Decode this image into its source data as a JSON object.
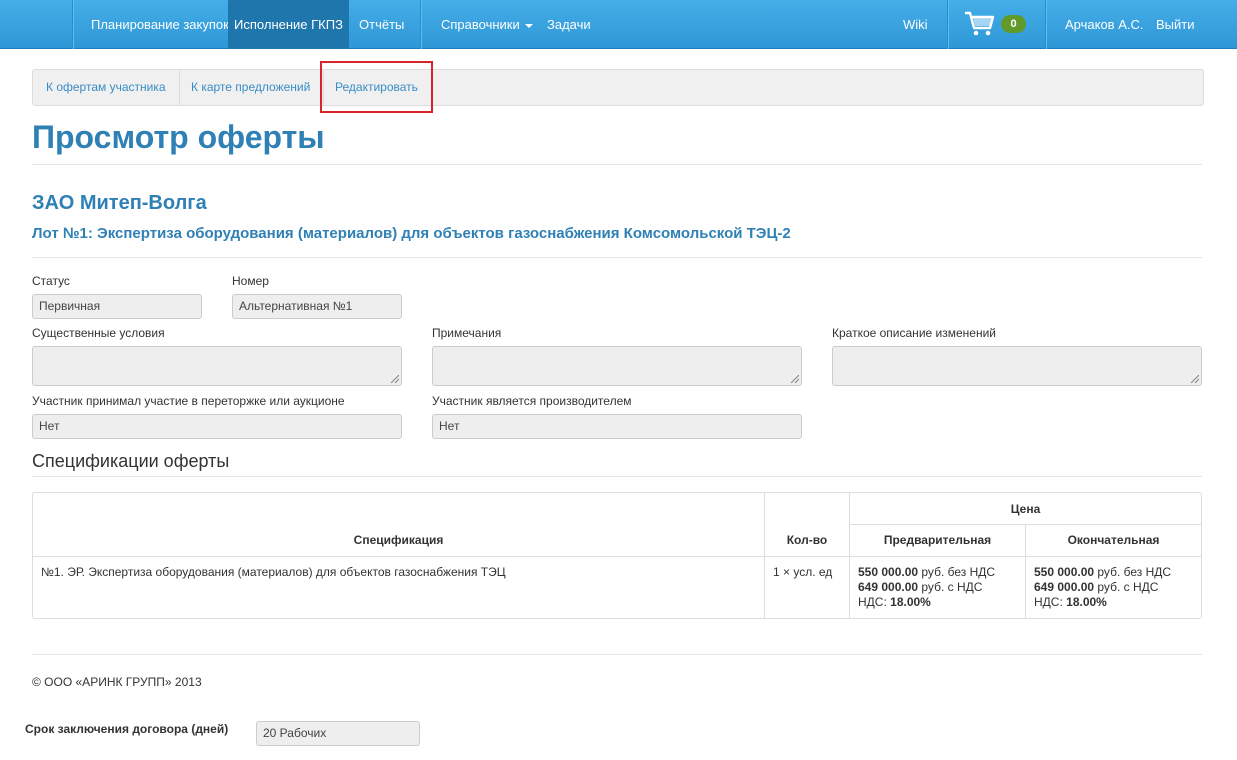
{
  "navbar": {
    "items": [
      "Планирование закупок",
      "Исполнение ГКПЗ",
      "Отчёты",
      "Справочники",
      "Задачи"
    ],
    "wiki": "Wiki",
    "cart_count": "0",
    "user": "Арчаков А.С.",
    "logout": "Выйти"
  },
  "tabs": [
    "К офертам участника",
    "К карте предложений",
    "Редактировать"
  ],
  "page_title": "Просмотр оферты",
  "company": "ЗАО Митеп-Волга",
  "lot": "Лот №1: Экспертиза оборудования (материалов) для объектов газоснабжения Комсомольской ТЭЦ-2",
  "form": {
    "status_label": "Статус",
    "status_value": "Первичная",
    "number_label": "Номер",
    "number_value": "Альтернативная №1",
    "conditions_label": "Существенные условия",
    "notes_label": "Примечания",
    "changes_label": "Краткое описание изменений",
    "auction_label": "Участник принимал участие в переторжке или аукционе",
    "auction_value": "Нет",
    "producer_label": "Участник является производителем",
    "producer_value": "Нет"
  },
  "spec_section_title": "Спецификации оферты",
  "table": {
    "headers": {
      "spec": "Спецификация",
      "qty": "Кол-во",
      "price": "Цена",
      "prelim": "Предварительная",
      "final": "Окончательная"
    },
    "rows": [
      {
        "spec": "№1. ЭР. Экспертиза оборудования (материалов) для объектов газоснабжения ТЭЦ",
        "qty": "1 × усл. ед",
        "prelim": {
          "net": "550 000.00",
          "net_suffix": " руб. без НДС",
          "gross": "649 000.00",
          "gross_suffix": " руб. с НДС",
          "vat_label": "НДС: ",
          "vat": "18.00%"
        },
        "final": {
          "net": "550 000.00",
          "net_suffix": " руб. без НДС",
          "gross": "649 000.00",
          "gross_suffix": " руб. с НДС",
          "vat_label": "НДС: ",
          "vat": "18.00%"
        }
      }
    ]
  },
  "footer": "© ООО «АРИНК ГРУПП» 2013",
  "contract_term": {
    "label": "Срок заключения договора (дней)",
    "value": "20 Рабочих"
  }
}
